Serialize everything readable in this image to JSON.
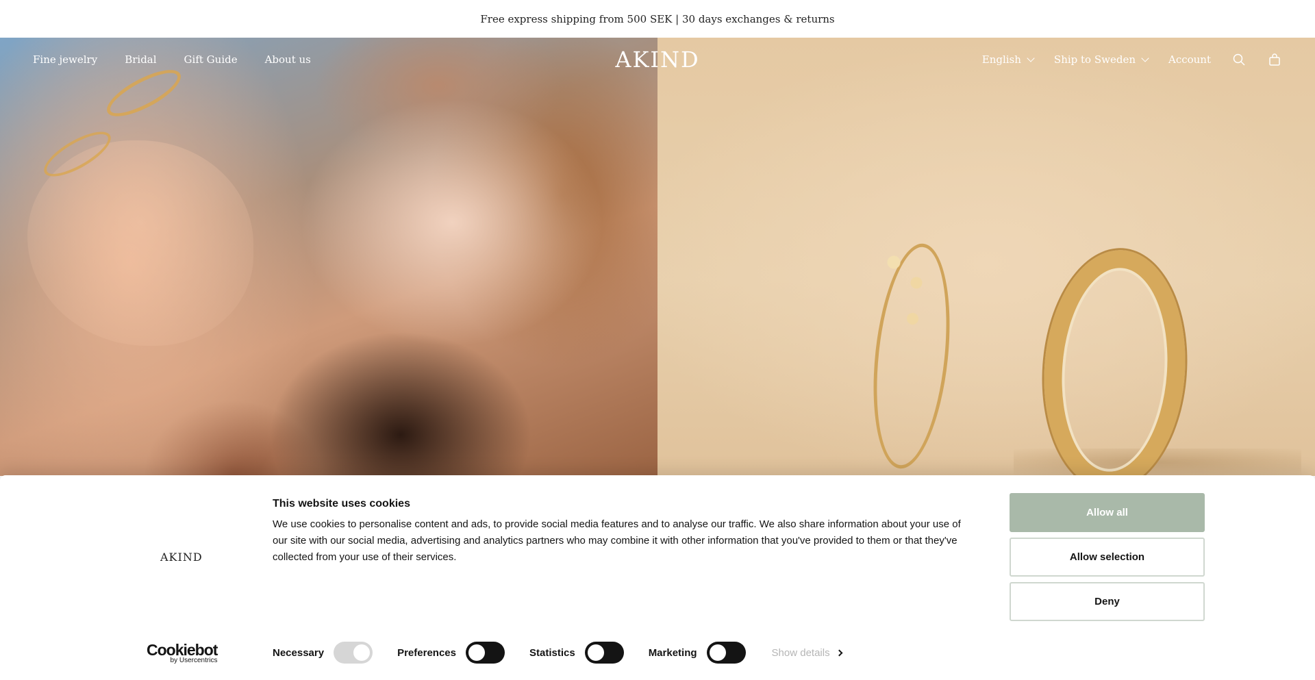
{
  "announcement": {
    "text": "Free express shipping from 500 SEK | 30 days exchanges & returns"
  },
  "nav": {
    "left": [
      {
        "label": "Fine jewelry"
      },
      {
        "label": "Bridal"
      },
      {
        "label": "Gift Guide"
      },
      {
        "label": "About us"
      }
    ],
    "logo": "AKIND",
    "language": "English",
    "ship_to": "Ship to Sweden",
    "account": "Account",
    "icons": [
      "search-icon",
      "bag-icon",
      "chevron-down-icon"
    ]
  },
  "cookie": {
    "brand": "AKIND",
    "title": "This website uses cookies",
    "body": "We use cookies to personalise content and ads, to provide social media features and to analyse our traffic. We also share information about your use of our site with our social media, advertising and analytics partners who may combine it with other information that you've provided to them or that they've collected from your use of their services.",
    "buttons": {
      "allow_all": "Allow all",
      "allow_selection": "Allow selection",
      "deny": "Deny"
    },
    "toggles": [
      {
        "label": "Necessary",
        "checked": true,
        "disabled": true
      },
      {
        "label": "Preferences",
        "checked": false
      },
      {
        "label": "Statistics",
        "checked": false
      },
      {
        "label": "Marketing",
        "checked": false
      }
    ],
    "show_details": "Show details",
    "cookiebot": {
      "name": "Cookiebot",
      "by": "by Usercentrics"
    }
  },
  "colors": {
    "allow_all_bg": "#a9b9a9",
    "toggle_off": "#141414",
    "toggle_disabled": "#d6d6d6",
    "text": "#141414"
  }
}
